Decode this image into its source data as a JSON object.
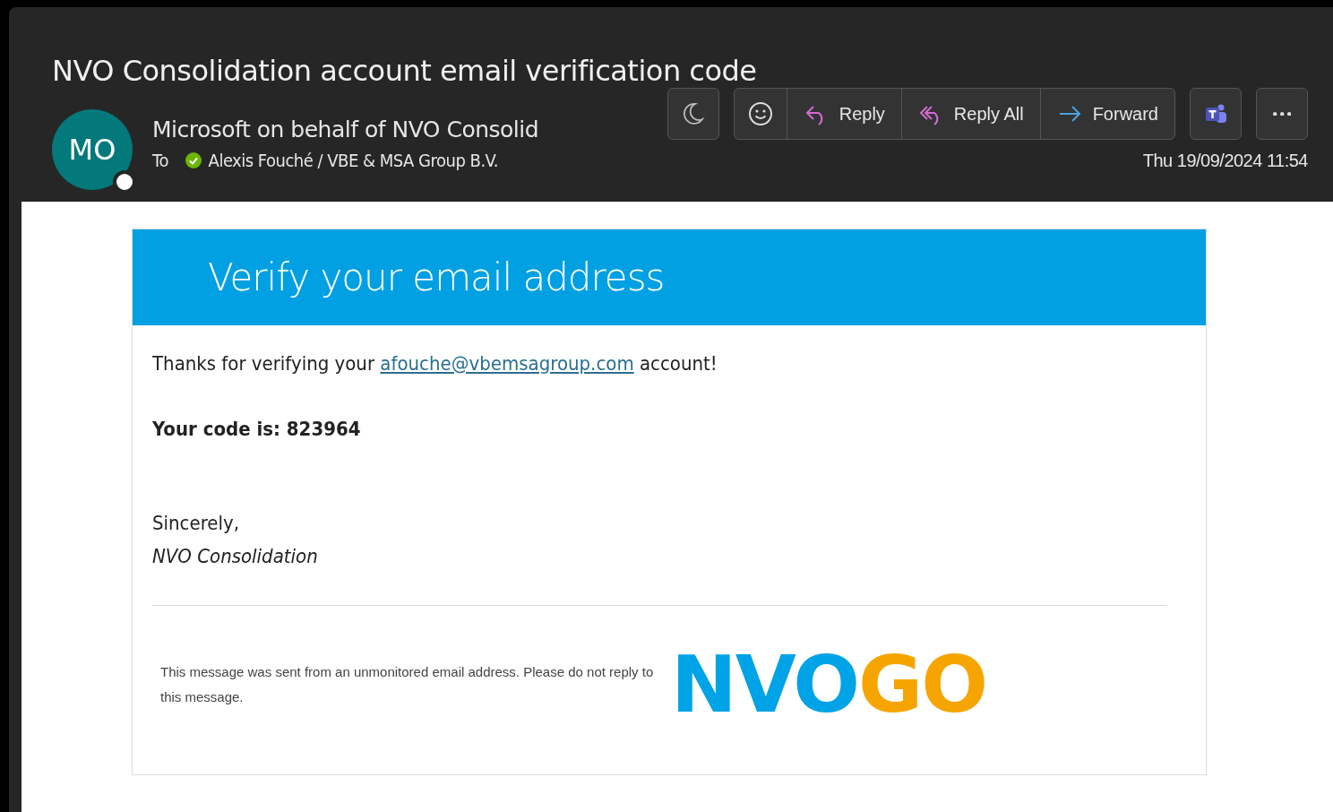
{
  "message": {
    "subject": "NVO Consolidation account email verification code",
    "avatar_initials": "MO",
    "sender": "Microsoft on behalf of NVO Consolid",
    "to_label": "To",
    "recipient": "Alexis Fouché / VBE & MSA Group B.V.",
    "date": "Thu 19/09/2024 11:54"
  },
  "toolbar": [
    {
      "kind": "moon"
    },
    {
      "kind": "group",
      "items": [
        {
          "kind": "emoji"
        },
        {
          "kind": "reply",
          "label": "Reply"
        },
        {
          "kind": "reply_all",
          "label": "Reply All"
        },
        {
          "kind": "forward",
          "label": "Forward"
        }
      ]
    },
    {
      "kind": "teams"
    },
    {
      "kind": "more"
    }
  ],
  "email": {
    "heading": "Verify your email address",
    "intro_before": "Thanks for verifying your ",
    "link": "afouche@vbemsagroup.com",
    "intro_after": " account!",
    "code_line": "Your code is: 823964",
    "closing": "Sincerely,",
    "signature": "NVO Consolidation",
    "footer_note": "This message was sent from an unmonitored email address. Please do not reply to this message.",
    "logo": [
      {
        "text": "NVO",
        "color": "#00a3e6"
      },
      {
        "text": "GO",
        "color": "#f6a500"
      }
    ]
  }
}
